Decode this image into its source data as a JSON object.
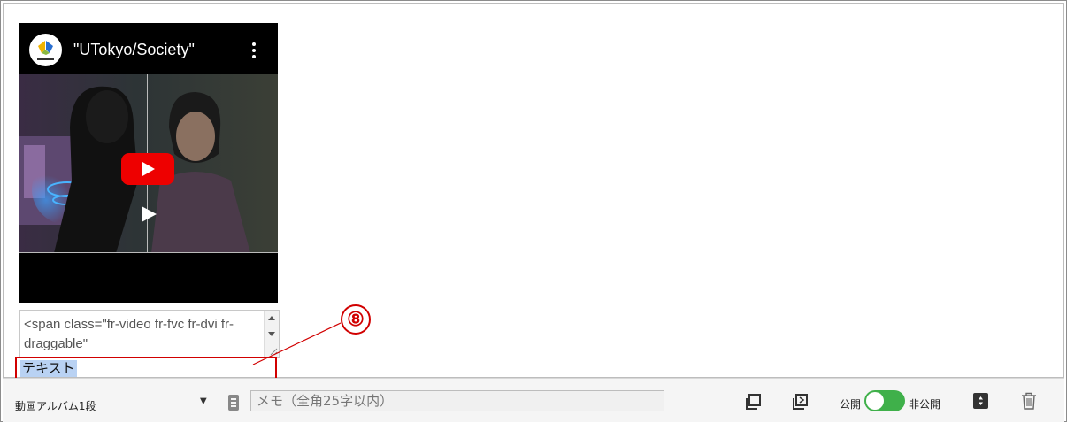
{
  "video": {
    "title": "\"UTokyo/Society\"",
    "channel_logo_label": "東京大学"
  },
  "code_area": {
    "value": "<span class=\"fr-video fr-fvc fr-dvi fr-draggable\""
  },
  "text_block": {
    "selected_text": "テキスト"
  },
  "callout": {
    "number": "⑧"
  },
  "toolbar": {
    "layout_select": "動画アルバム1段",
    "memo_placeholder": "メモ（全角25字以内）",
    "public_label": "公開",
    "private_label": "非公開",
    "toggle_on": true
  },
  "colors": {
    "highlight_border": "#d10000",
    "toggle": "#3fb04a",
    "youtube_red": "#e00000",
    "selection": "#b9d2f3"
  }
}
